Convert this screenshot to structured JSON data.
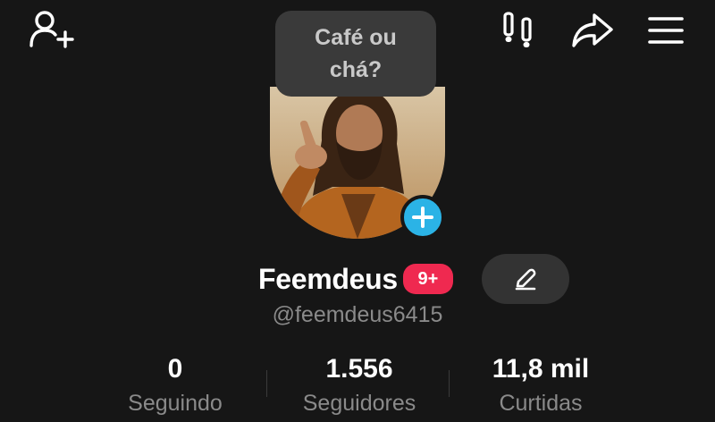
{
  "header": {
    "icons": [
      "add-friend-icon",
      "footprints-icon",
      "share-icon",
      "menu-icon"
    ]
  },
  "note": {
    "text": "Café ou chá?"
  },
  "profile": {
    "display_name": "Feemdeus",
    "badge": "9+",
    "username": "@feemdeus6415",
    "add_avatar_icon": "plus-icon",
    "edit_icon": "pencil-icon"
  },
  "stats": [
    {
      "value": "0",
      "label": "Seguindo"
    },
    {
      "value": "1.556",
      "label": "Seguidores"
    },
    {
      "value": "11,8 mil",
      "label": "Curtidas"
    }
  ],
  "colors": {
    "background": "#161616",
    "accent_badge": "#ef2950",
    "add_button": "#2bb3e6",
    "secondary_text": "#8a8a8a"
  }
}
